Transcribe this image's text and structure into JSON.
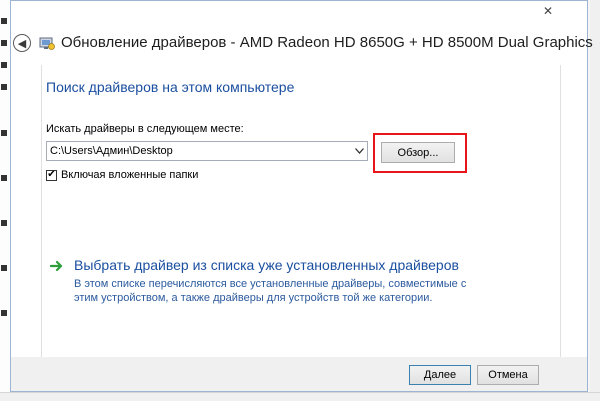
{
  "window": {
    "close_glyph": "✕",
    "title": "Обновление драйверов - AMD Radeon HD 8650G + HD 8500M Dual Graphics",
    "back_glyph": "◀"
  },
  "search": {
    "heading": "Поиск драйверов на этом компьютере",
    "location_label": "Искать драйверы в следующем месте:",
    "path_value": "C:\\Users\\Админ\\Desktop",
    "browse_label": "Обзор...",
    "include_subfolders_label": "Включая вложенные папки",
    "include_subfolders_checked": true,
    "check_glyph": "✔"
  },
  "pick_from_list": {
    "title": "Выбрать драйвер из списка уже установленных драйверов",
    "description": "В этом списке перечисляются все установленные драйверы, совместимые с этим устройством, а также драйверы для устройств той же категории."
  },
  "footer": {
    "next_label": "Далее",
    "cancel_label": "Отмена"
  },
  "colors": {
    "link_blue": "#1b4fa0",
    "highlight_red": "#e8161b",
    "arrow_green": "#2e9e3a"
  },
  "icons": {
    "back": "back-arrow-icon",
    "wizard": "device-wizard-icon",
    "link_arrow": "green-right-arrow-icon",
    "combo": "chevron-down-icon"
  }
}
